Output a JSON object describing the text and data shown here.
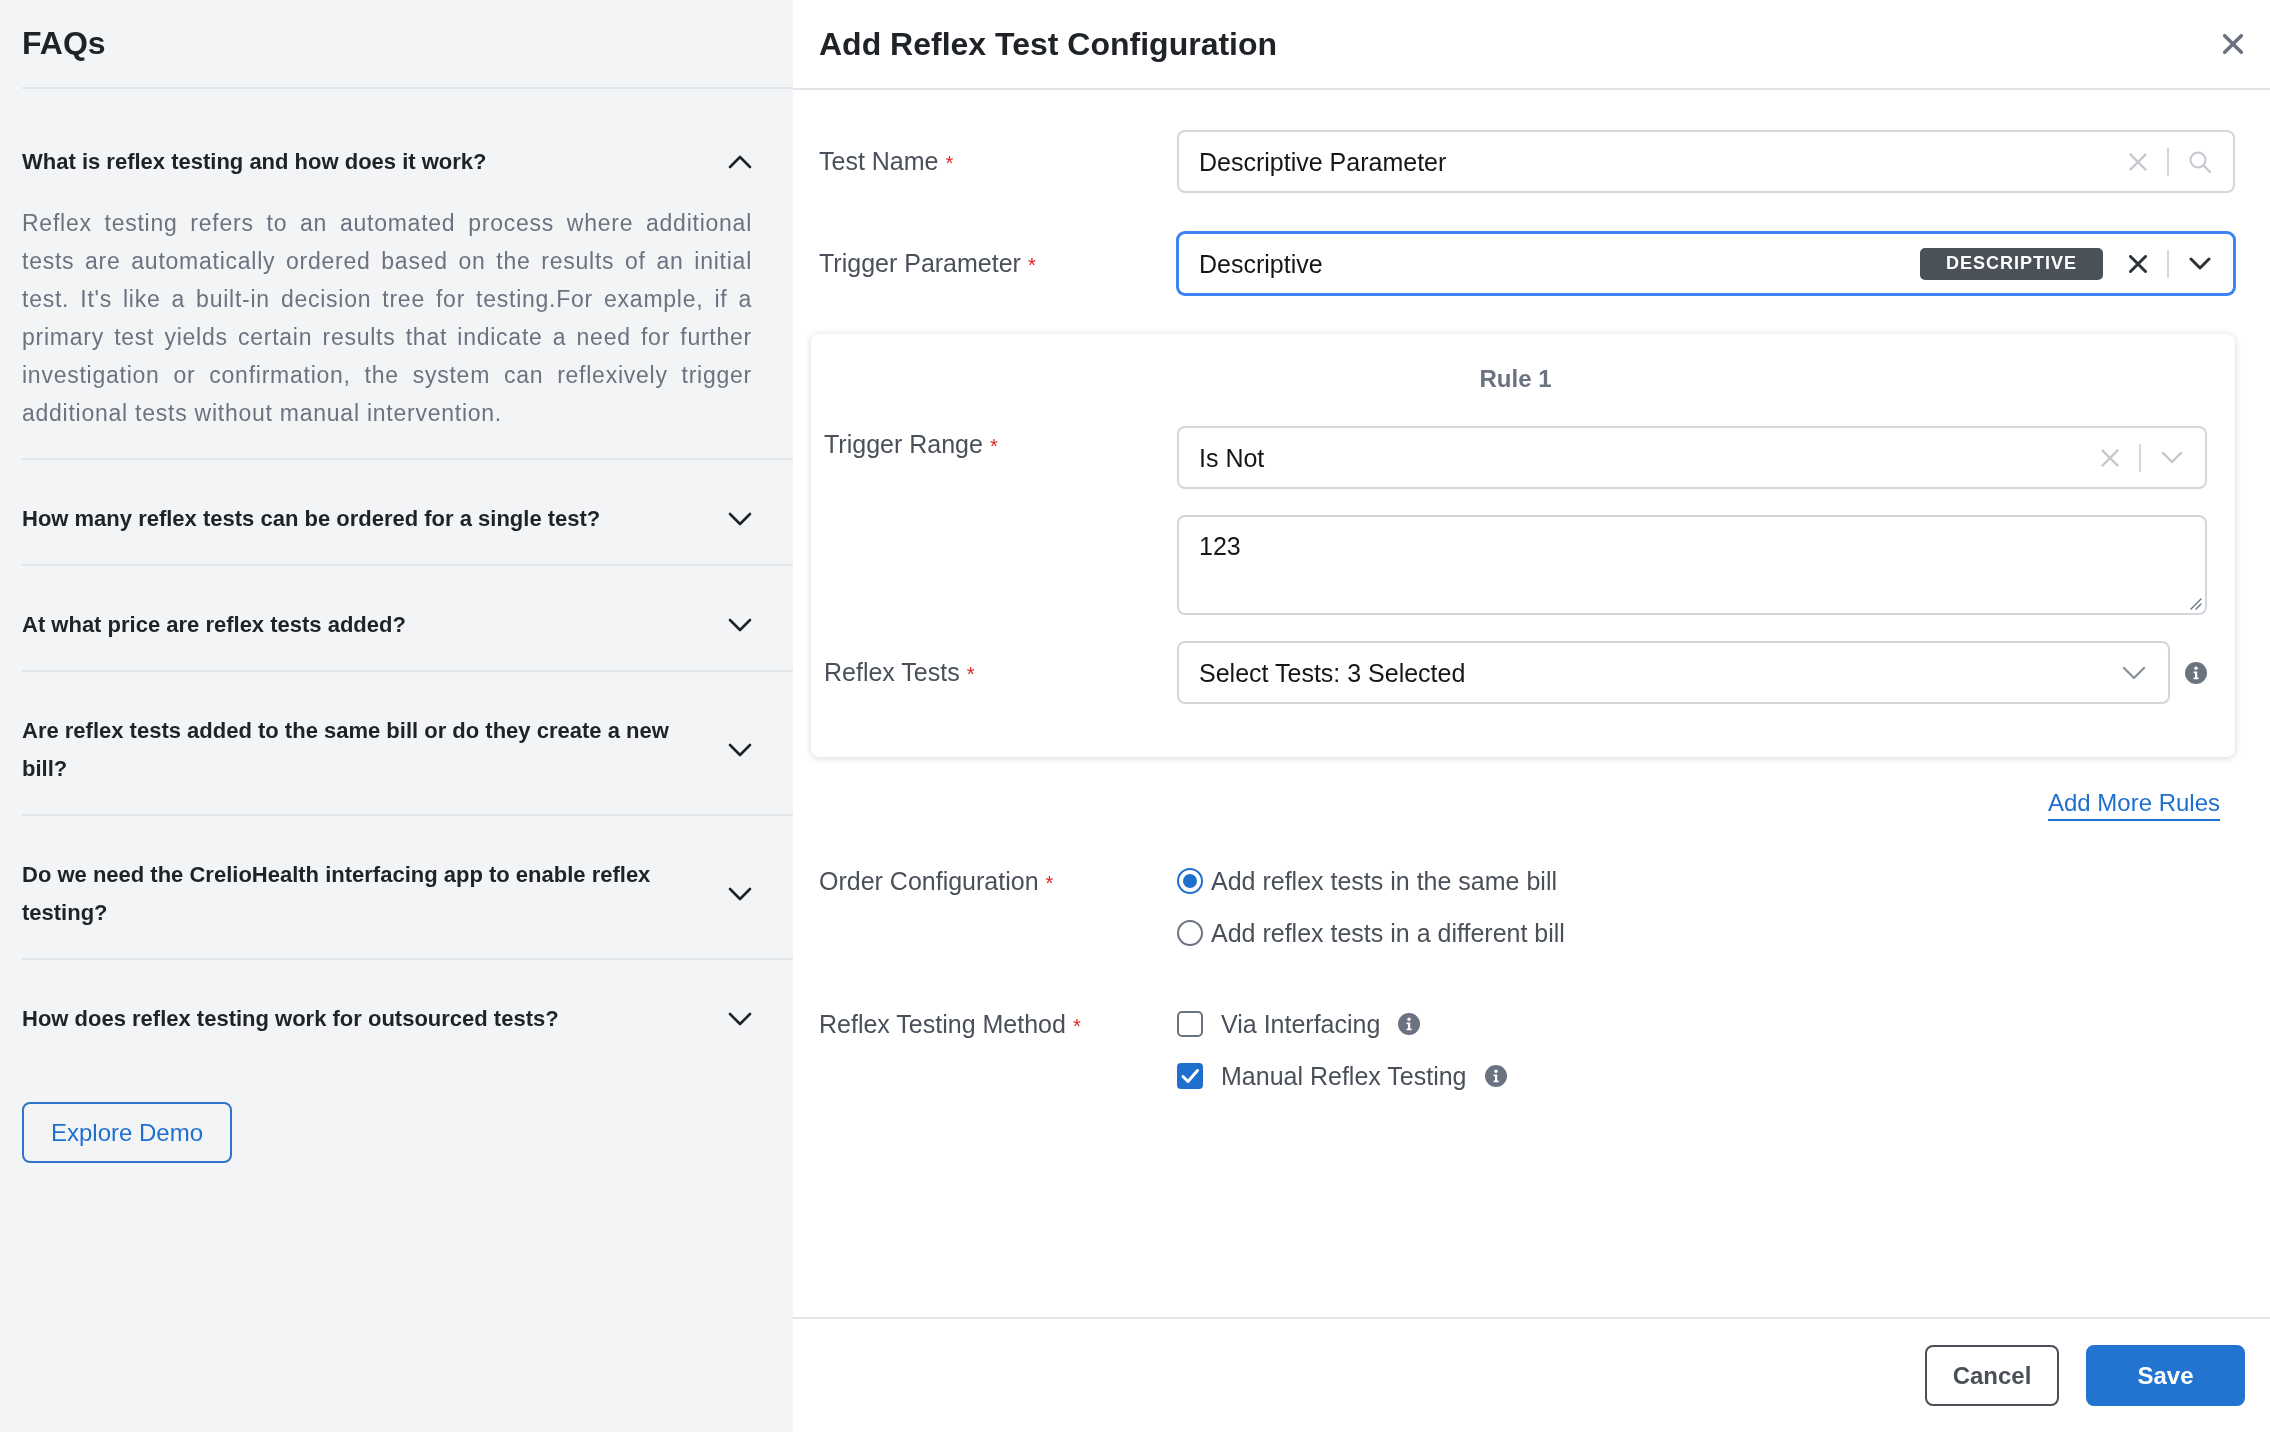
{
  "faq": {
    "title": "FAQs",
    "items": [
      {
        "question": "What is reflex testing and how does it work?",
        "expanded": true,
        "answer": "Reflex testing refers to an automated process where additional tests are automatically ordered based on the results of an initial test. It's like a built-in decision tree for testing.For example, if a primary test yields certain results that indicate a need for further investigation or confirmation, the system can reflexively trigger additional tests without manual intervention."
      },
      {
        "question": "How many reflex tests can be ordered for a single test?",
        "expanded": false
      },
      {
        "question": "At what price are reflex tests added?",
        "expanded": false
      },
      {
        "question": "Are reflex tests added to the same bill or do they create a new bill?",
        "expanded": false
      },
      {
        "question": "Do we need the CrelioHealth interfacing app to enable reflex testing?",
        "expanded": false
      },
      {
        "question": "How does reflex testing work for outsourced tests?",
        "expanded": false
      }
    ],
    "demo_button": "Explore Demo"
  },
  "dialog": {
    "title": "Add Reflex Test Configuration",
    "fields": [
      {
        "kind": "search",
        "label": "Test Name",
        "required_mark": "*",
        "value": "Descriptive Parameter",
        "focused": false
      },
      {
        "kind": "select",
        "label": "Trigger Parameter",
        "required_mark": "*",
        "value": "Descriptive",
        "badge": "DESCRIPTIVE",
        "focused": true
      }
    ],
    "rules": [
      {
        "title": "Rule 1",
        "fields": [
          {
            "kind": "select",
            "label": "Trigger Range",
            "required_mark": "*",
            "value": "Is Not",
            "focused": false
          },
          {
            "kind": "textarea",
            "value": "123",
            "focused": false
          },
          {
            "kind": "multiselect",
            "label": "Reflex Tests",
            "required_mark": "*",
            "value": "Select Tests: 3 Selected",
            "focused": false
          }
        ]
      }
    ],
    "add_rule_link": "Add More Rules",
    "order_configuration": {
      "label": "Order Configuration",
      "required_mark": "*",
      "options": [
        {
          "label": "Add reflex tests in the same bill",
          "selected": true
        },
        {
          "label": "Add reflex tests in a different bill",
          "selected": false
        }
      ]
    },
    "reflex_testing_method": {
      "label": "Reflex Testing Method",
      "required_mark": "*",
      "options": [
        {
          "label": "Via Interfacing",
          "checked": false
        },
        {
          "label": "Manual Reflex Testing",
          "checked": true
        }
      ]
    },
    "buttons": [
      {
        "label": "Cancel",
        "kind": "secondary"
      },
      {
        "label": "Save",
        "kind": "primary"
      }
    ]
  }
}
